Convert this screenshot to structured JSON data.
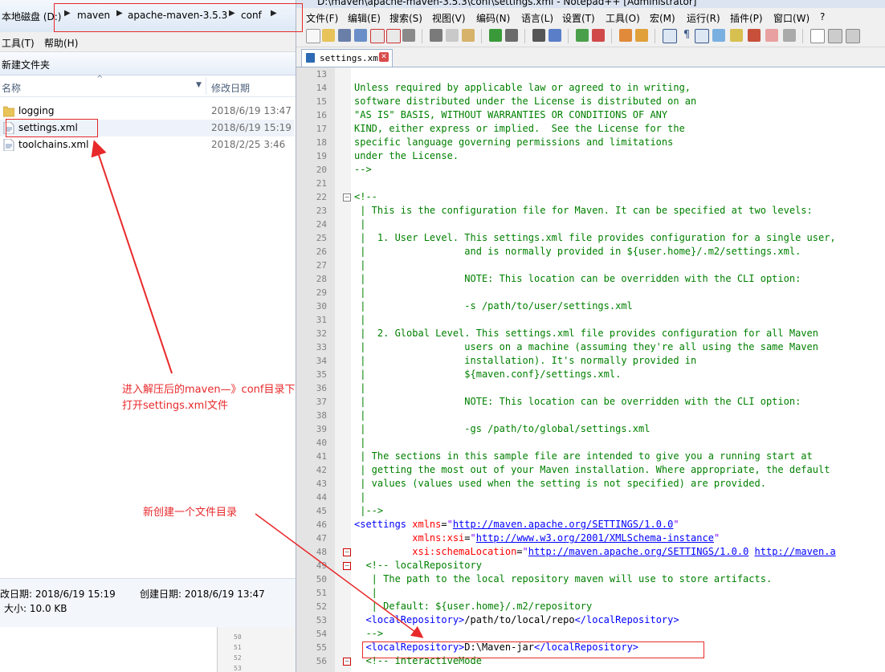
{
  "explorer": {
    "address_prefix": "本地磁盘 (D:)",
    "breadcrumbs": [
      "maven",
      "apache-maven-3.5.3",
      "conf"
    ],
    "menu": [
      "工具(T)",
      "帮助(H)"
    ],
    "toolbar": {
      "new_folder": "新建文件夹"
    },
    "columns": {
      "name": "名称",
      "modified": "修改日期"
    },
    "files": [
      {
        "name": "logging",
        "date": "2018/6/19 13:47",
        "icon": "folder-icon"
      },
      {
        "name": "settings.xml",
        "date": "2018/6/19 15:19",
        "icon": "xml-file-icon"
      },
      {
        "name": "toolchains.xml",
        "date": "2018/2/25 3:46",
        "icon": "xml-file-icon"
      }
    ],
    "details": {
      "modified": "改日期: 2018/6/19 15:19",
      "created": "创建日期: 2018/6/19 13:47",
      "size": "大小: 10.0 KB"
    },
    "mini_lines": [
      "50",
      "51",
      "52",
      "53"
    ]
  },
  "notepad": {
    "title": "D:\\maven\\apache-maven-3.5.3\\conf\\settings.xml - Notepad++ [Administrator]",
    "menu": [
      "文件(F)",
      "编辑(E)",
      "搜索(S)",
      "视图(V)",
      "编码(N)",
      "语言(L)",
      "设置(T)",
      "工具(O)",
      "宏(M)",
      "运行(R)",
      "插件(P)",
      "窗口(W)",
      "?"
    ],
    "tab": {
      "label": "settings.xml",
      "close": "✕"
    }
  },
  "annotations": {
    "note1_line1": "进入解压后的maven—》conf目录下",
    "note1_line2": "打开settings.xml文件",
    "note2": "新创建一个文件目录"
  },
  "accent_colors": {
    "annotation": "#e8292b",
    "tag": "#0000ff",
    "comment": "#008000",
    "attr": "#ff0000",
    "string": "#8000ff"
  }
}
